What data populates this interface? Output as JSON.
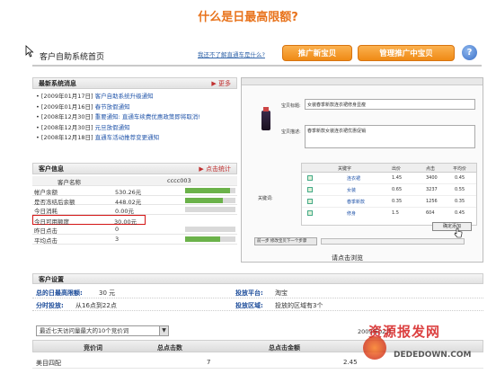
{
  "heading": "什么是日最高限额?",
  "topbar": {
    "title": "客户自助系统首页",
    "help_text": "我还不了解直通车是什么?",
    "btn_new": "推广新宝贝",
    "btn_manage": "管理推广中宝贝",
    "help_icon": "?"
  },
  "news": {
    "header": "最新系统消息",
    "more": "更多",
    "items": [
      {
        "date": "[2009年01月17日]",
        "title": "客户自助系统升级通知"
      },
      {
        "date": "[2009年01月16日]",
        "title": "春节放假通知"
      },
      {
        "date": "[2008年12月30日]",
        "title": "重要通知: 直通车续费优惠政策即将取消!"
      },
      {
        "date": "[2008年12月30日]",
        "title": "元旦放假通知"
      },
      {
        "date": "[2008年12月18日]",
        "title": "直通车活动推荐变更通知"
      }
    ]
  },
  "info": {
    "header": "客户信息",
    "stats_link": "点击统计",
    "rows": [
      {
        "label": "客户名称",
        "value": "cccc003",
        "bar": null
      },
      {
        "label": "帐户余额",
        "value": "530.26元",
        "bar": 0.9
      },
      {
        "label": "是否冻结后余额",
        "value": "448.02元",
        "bar": 0.75
      },
      {
        "label": "今日消耗",
        "value": "0.00元",
        "bar": 0
      },
      {
        "label": "今日可用额度",
        "value": "30.00元",
        "bar": 0
      },
      {
        "label": "昨日点击",
        "value": "0",
        "bar": 0
      },
      {
        "label": "平均点击",
        "value": "3",
        "bar": 0.7
      }
    ]
  },
  "preview": {
    "caption": "请点击浏览",
    "title_label": "宝贝标题:",
    "title_value": "女装春季新款连衣裙修身显瘦",
    "desc_label": "宝贝描述:",
    "desc_value": "春季新款女装连衣裙优惠促销",
    "keywords_label": "关键词:",
    "kw_head": [
      "关键字",
      "出价",
      "点击",
      "平均价"
    ],
    "kw_rows": [
      [
        "连衣裙",
        "1.45",
        "3400",
        "0.45"
      ],
      [
        "女装",
        "0.65",
        "3237",
        "0.55"
      ],
      [
        "春季新款",
        "0.35",
        "1256",
        "0.35"
      ],
      [
        "修身",
        "1.5",
        "604",
        "0.45"
      ]
    ],
    "confirm_btn": "确定添加",
    "prev_label": "前一步 修改宝贝下一个步骤"
  },
  "settings": {
    "header": "客户设置",
    "daily_limit_label": "总的日最高限额:",
    "daily_limit_value": "30 元",
    "platform_label": "投放平台:",
    "platform_value": "淘宝",
    "time_label": "分时投放:",
    "time_value": "从16点到22点",
    "region_label": "投放区域:",
    "region_value": "投放的区域有3个"
  },
  "stats": {
    "dropdown": "最近七天访问量最大的10个竞价词",
    "date": "2009年02月",
    "columns": [
      "竞价词",
      "总点击数",
      "总点击金额"
    ],
    "rows": [
      {
        "word": "美目四配",
        "clicks": "7",
        "amount": "2.45"
      }
    ]
  },
  "watermark": {
    "line1": "资源报发网",
    "line2": "DEDEDOWN.COM"
  },
  "colors": {
    "accent_orange": "#e8731c",
    "highlight_red": "#d41515",
    "bar_green": "#6bb24a",
    "link_blue": "#2255aa"
  }
}
